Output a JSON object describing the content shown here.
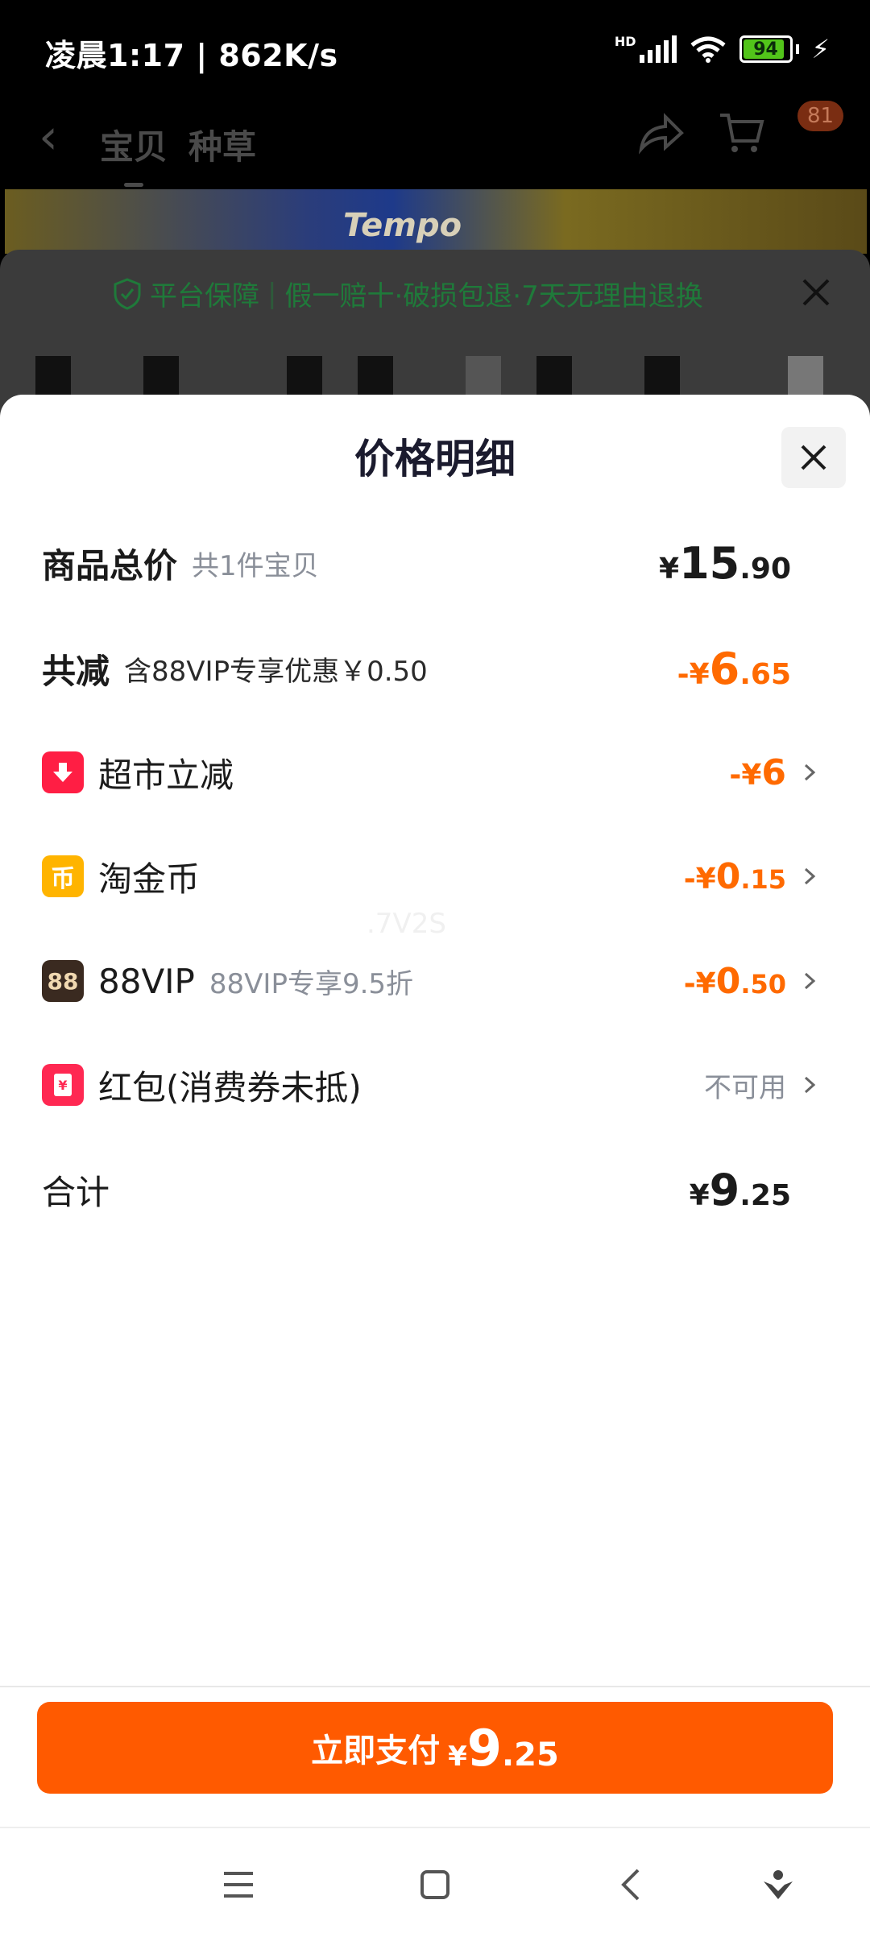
{
  "status_bar": {
    "time_speed": "凌晨1:17 | 862K/s",
    "network": "HD",
    "battery": "94"
  },
  "background_page": {
    "tabs": [
      "宝贝",
      "种草"
    ],
    "cart_badge": "81",
    "product_brand": "Tempo",
    "guarantee_label": "平台保障",
    "guarantee_terms": "假一赔十·破损包退·7天无理由退换"
  },
  "sheet": {
    "title": "价格明细",
    "total": {
      "label": "商品总价",
      "sub": "共1件宝贝",
      "currency": "¥",
      "int": "15",
      "dec": ".90"
    },
    "discount_total": {
      "label": "共减",
      "sub": "含88VIP专享优惠￥0.50",
      "prefix": "-¥",
      "int": "6",
      "dec": ".65"
    },
    "items": [
      {
        "label": "超市立减",
        "sub": "",
        "prefix": "-¥",
        "int": "6",
        "dec": "",
        "badge_color": "#ff1e44",
        "icon": "arrow-down-icon"
      },
      {
        "label": "淘金币",
        "sub": "",
        "prefix": "-¥",
        "int": "0",
        "dec": ".15",
        "badge_color": "#ffb400",
        "icon": "coin-icon"
      },
      {
        "label": "88VIP",
        "sub": "88VIP专享9.5折",
        "prefix": "-¥",
        "int": "0",
        "dec": ".50",
        "badge_text": "88",
        "badge_color": "#3a2a20",
        "icon": "vip-88-icon"
      },
      {
        "label": "红包(消费券未抵)",
        "status": "不可用",
        "badge_color": "#ff2852",
        "icon": "red-packet-icon"
      }
    ],
    "sum": {
      "label": "合计",
      "currency": "¥",
      "int": "9",
      "dec": ".25"
    },
    "watermark": ".7V2S"
  },
  "pay_button": {
    "label": "立即支付",
    "currency": "¥",
    "int": "9",
    "dec": ".25"
  },
  "colors": {
    "accent_orange": "#ff6a00",
    "pay_button": "#ff5a00"
  }
}
